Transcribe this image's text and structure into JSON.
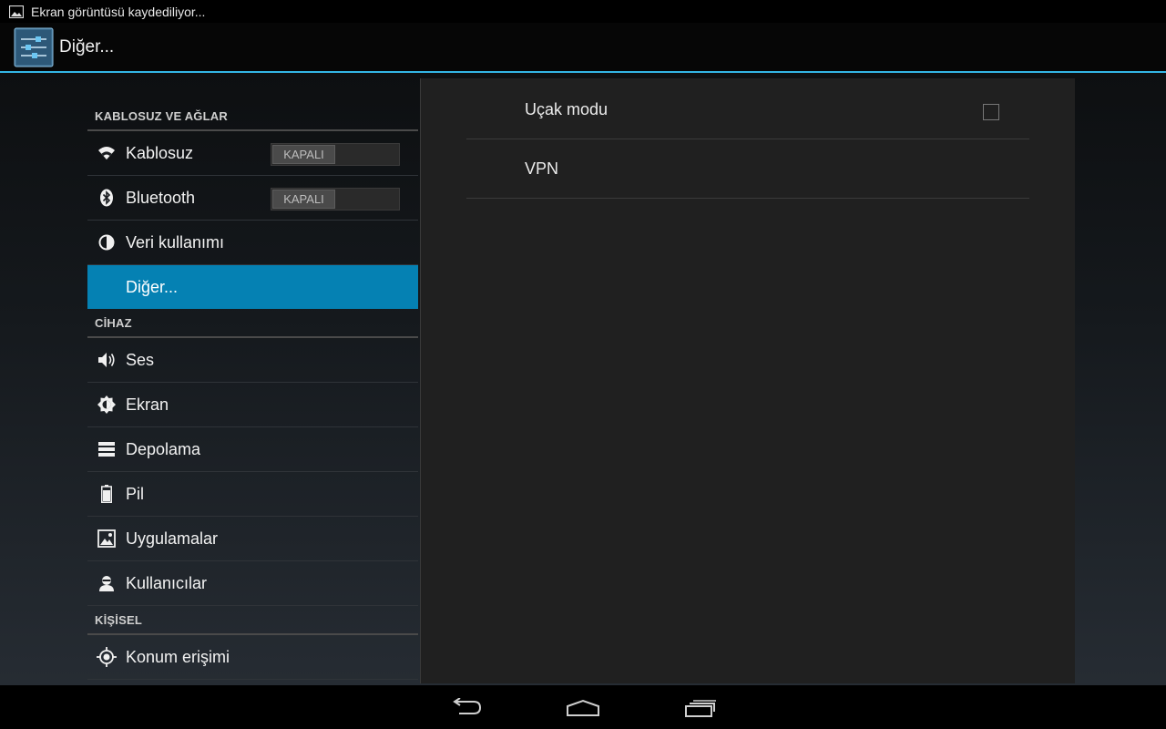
{
  "status_bar": {
    "notification_icon": "image-icon",
    "text": "Ekran görüntüsü kaydediliyor..."
  },
  "action_bar": {
    "app_icon": "settings-sliders-icon",
    "title": "Diğer..."
  },
  "sections": {
    "wireless": "KABLOSUZ VE AĞLAR",
    "device": "CİHAZ",
    "personal": "KİŞİSEL"
  },
  "items": {
    "wifi": {
      "label": "Kablosuz",
      "icon": "wifi-icon",
      "toggle": "KAPALI"
    },
    "bluetooth": {
      "label": "Bluetooth",
      "icon": "bluetooth-icon",
      "toggle": "KAPALI"
    },
    "data_usage": {
      "label": "Veri kullanımı",
      "icon": "data-usage-icon"
    },
    "more": {
      "label": "Diğer...",
      "selected": true
    },
    "sound": {
      "label": "Ses",
      "icon": "speaker-icon"
    },
    "display": {
      "label": "Ekran",
      "icon": "brightness-icon"
    },
    "storage": {
      "label": "Depolama",
      "icon": "storage-icon"
    },
    "battery": {
      "label": "Pil",
      "icon": "battery-icon"
    },
    "apps": {
      "label": "Uygulamalar",
      "icon": "apps-icon"
    },
    "users": {
      "label": "Kullanıcılar",
      "icon": "user-icon"
    },
    "location": {
      "label": "Konum erişimi",
      "icon": "location-icon"
    }
  },
  "detail": {
    "airplane_mode": {
      "label": "Uçak modu",
      "checked": false
    },
    "vpn": {
      "label": "VPN"
    }
  },
  "nav_bar": {
    "back": "back-icon",
    "home": "home-icon",
    "recents": "recents-icon"
  },
  "colors": {
    "accent": "#33b5e5",
    "selected_bg": "#0581b3"
  }
}
